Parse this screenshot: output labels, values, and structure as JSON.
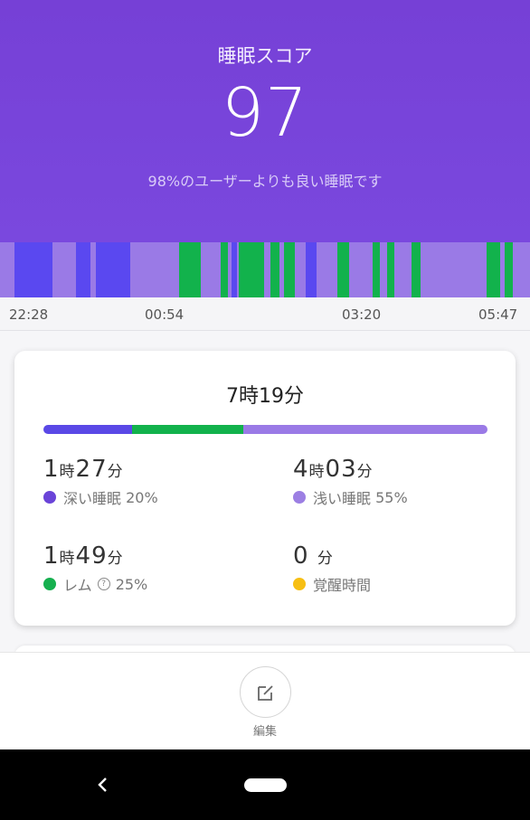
{
  "header": {
    "title": "睡眠スコア",
    "score": "97",
    "subtitle": "98%のユーザーよりも良い睡眠です"
  },
  "timeline": {
    "ticks": [
      "22:28",
      "00:54",
      "03:20",
      "05:47"
    ],
    "stage_colors": {
      "deep": "#5a48f0",
      "light": "#9a7ae6",
      "rem": "#12b24c",
      "awake": "#f6b90e"
    }
  },
  "summary": {
    "total_duration": "7時19分",
    "stats": {
      "deep": {
        "hours": "1",
        "hour_unit": "時",
        "minutes": "27",
        "minute_unit": "分",
        "label": "深い睡眠",
        "percent": "20%",
        "color": "#6a44d8"
      },
      "light": {
        "hours": "4",
        "hour_unit": "時",
        "minutes": "03",
        "minute_unit": "分",
        "label": "浅い睡眠",
        "percent": "55%",
        "color": "#9c7fe3"
      },
      "rem": {
        "hours": "1",
        "hour_unit": "時",
        "minutes": "49",
        "minute_unit": "分",
        "label": "レム",
        "help_glyph": "?",
        "percent": "25%",
        "color": "#16b04f"
      },
      "awake": {
        "minutes": "0",
        "minute_unit": "分",
        "label": "覚醒時間",
        "color": "#f7bf13"
      }
    },
    "ratio_fractions": {
      "deep": 0.2,
      "rem": 0.25,
      "light": 0.55
    }
  },
  "bottom": {
    "edit_label": "編集",
    "edit_icon": "edit-icon"
  },
  "nav": {
    "back_icon": "back-chevron-icon",
    "home_icon": "home-pill-icon"
  }
}
